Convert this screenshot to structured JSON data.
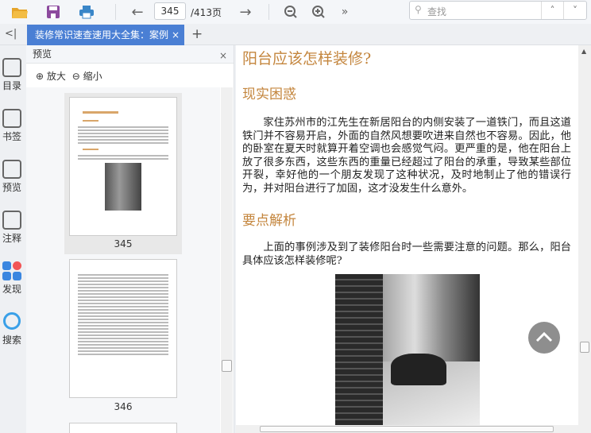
{
  "toolbar": {
    "page_current": "345",
    "page_total": "/413页",
    "search_placeholder": "查找",
    "more": "»"
  },
  "tabs": {
    "collapse": "<|",
    "active": "装修常识速查速用大全集：案例",
    "close": "×",
    "add": "+"
  },
  "sidebar": {
    "items": [
      {
        "label": "目录"
      },
      {
        "label": "书签"
      },
      {
        "label": "预览"
      },
      {
        "label": "注释"
      },
      {
        "label": "发现"
      },
      {
        "label": "搜索"
      }
    ]
  },
  "preview": {
    "title": "预览",
    "close": "×",
    "zoom_in": "放大",
    "zoom_out": "缩小",
    "pages": [
      {
        "number": "345"
      },
      {
        "number": "346"
      }
    ]
  },
  "document": {
    "title": "阳台应该怎样装修?",
    "section1": "现实困惑",
    "para1": "家住苏州市的江先生在新居阳台的内侧安装了一道铁门，而且这道铁门并不容易开启，外面的自然风想要吹进来自然也不容易。因此，他的卧室在夏天时就算开着空调也会感觉气闷。更严重的是，他在阳台上放了很多东西，这些东西的重量已经超过了阳台的承重，导致某些部位开裂，幸好他的一个朋友发现了这种状况，及时地制止了他的错误行为，并对阳台进行了加固，这才没发生什么意外。",
    "section2": "要点解析",
    "para2": "上面的事例涉及到了装修阳台时一些需要注意的问题。那么，阳台具体应该怎样装修呢?"
  },
  "colors": {
    "accent": "#4a7fd4",
    "heading": "#c4863e"
  }
}
